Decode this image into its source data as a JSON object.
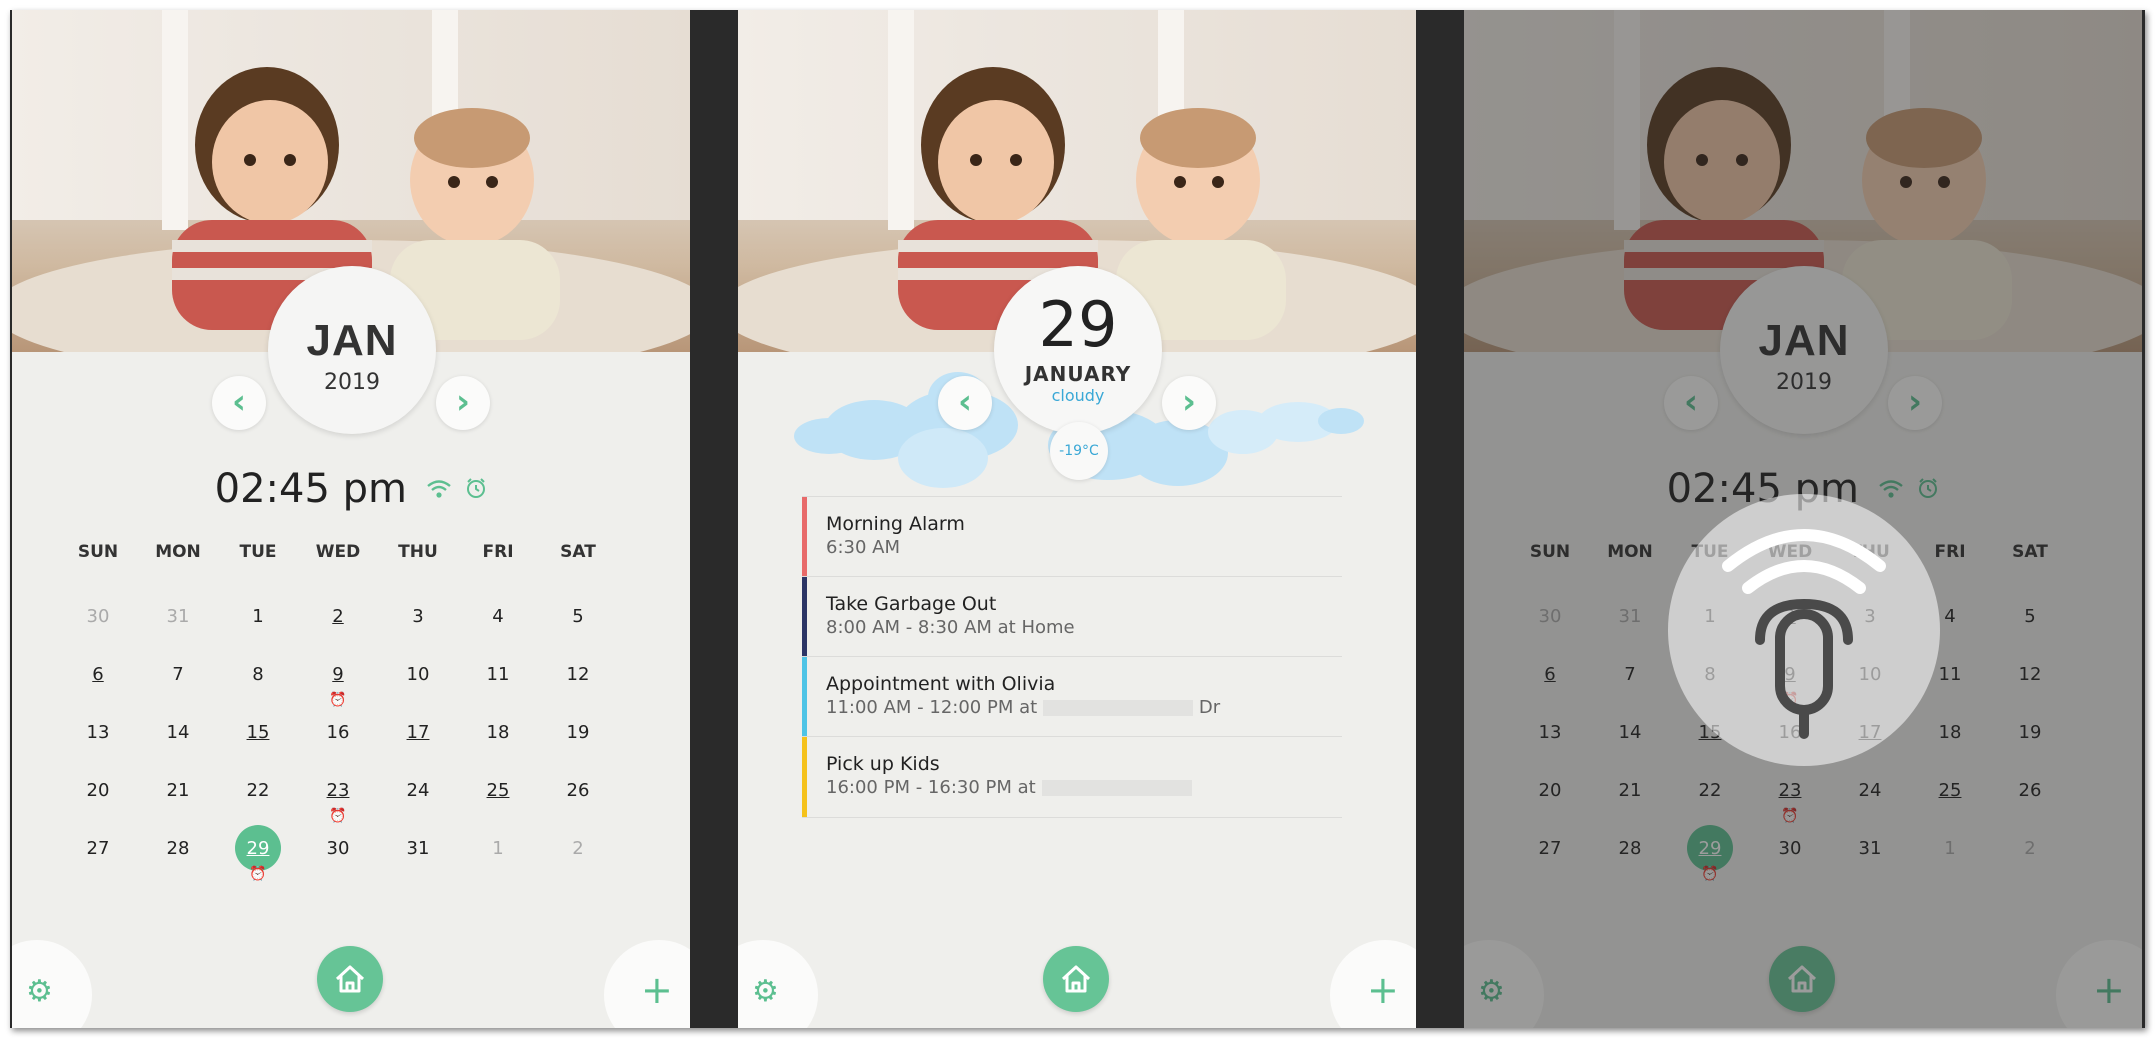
{
  "colors": {
    "accent": "#5cbf90",
    "today": "#5cbf90",
    "sky": "#3aa8d6"
  },
  "icons": {
    "prev": "chevron-left-icon",
    "next": "chevron-right-icon",
    "wifi": "wifi-icon",
    "alarm": "alarm-clock-icon",
    "settings": "gear-icon",
    "home": "home-icon",
    "add": "plus-icon",
    "voice": "microphone-icon"
  },
  "calendar": {
    "month": "JAN",
    "year": "2019",
    "time": "02:45 pm",
    "weekdays": [
      "SUN",
      "MON",
      "TUE",
      "WED",
      "THU",
      "FRI",
      "SAT"
    ],
    "weeks": [
      [
        "30",
        "31",
        "1",
        "2",
        "3",
        "4",
        "5"
      ],
      [
        "6",
        "7",
        "8",
        "9",
        "10",
        "11",
        "12"
      ],
      [
        "13",
        "14",
        "15",
        "16",
        "17",
        "18",
        "19"
      ],
      [
        "20",
        "21",
        "22",
        "23",
        "24",
        "25",
        "26"
      ],
      [
        "27",
        "28",
        "29",
        "30",
        "31",
        "1",
        "2"
      ]
    ],
    "today": "29"
  },
  "day_view": {
    "day": "29",
    "month": "JANUARY",
    "condition": "cloudy",
    "temperature": "-19°C",
    "events": [
      {
        "title": "Morning Alarm",
        "detail": "6:30 AM",
        "color": "#e86a6a"
      },
      {
        "title": "Take Garbage Out",
        "detail": "8:00 AM - 8:30 AM at Home",
        "color": "#2c3566"
      },
      {
        "title": "Appointment with Olivia",
        "detail": "11:00 AM - 12:00 PM at",
        "detail_suffix": "Dr",
        "color": "#4ec4e6"
      },
      {
        "title": "Pick up Kids",
        "detail": "16:00 PM - 16:30 PM at",
        "color": "#f5c21b"
      }
    ]
  }
}
